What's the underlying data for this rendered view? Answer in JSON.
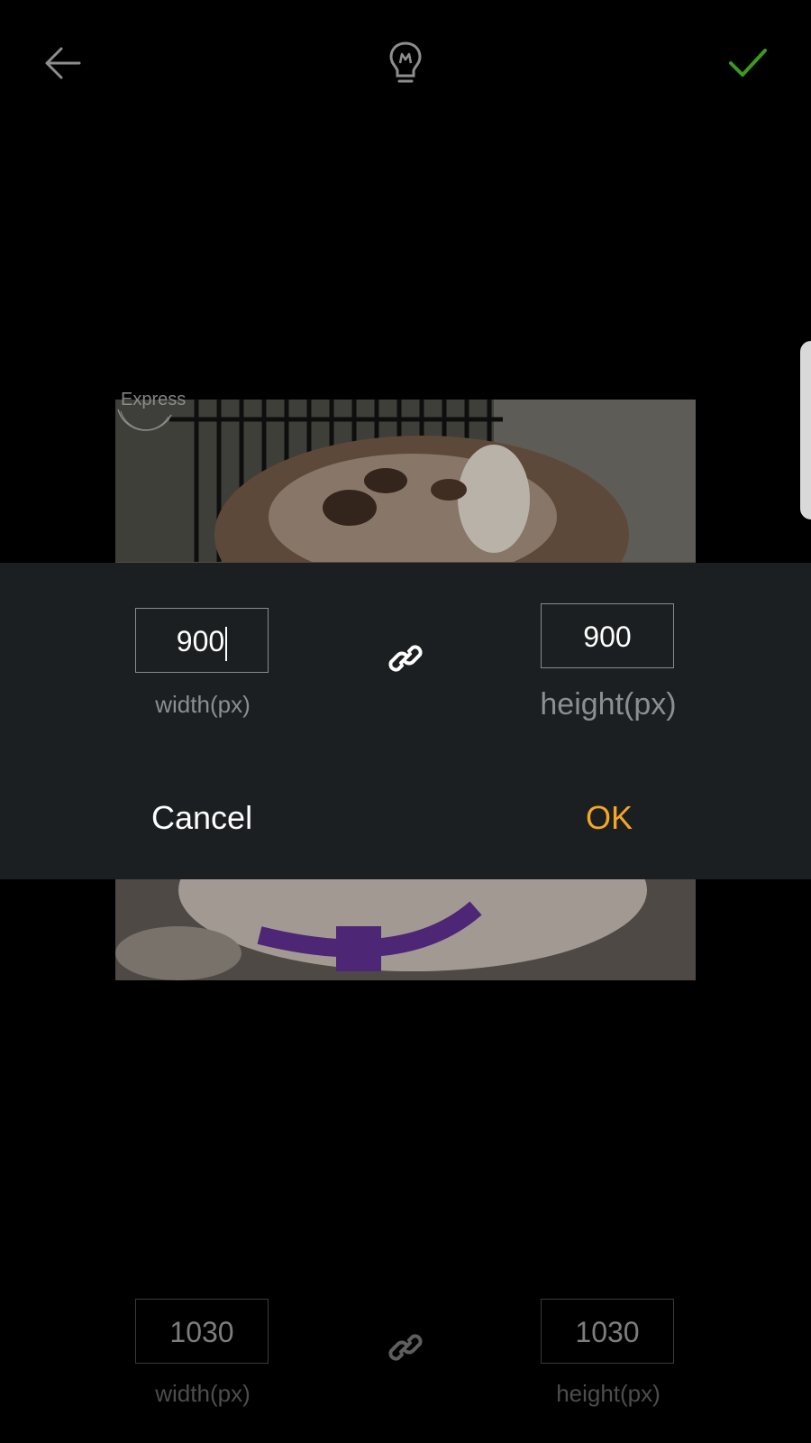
{
  "toolbar": {
    "back_icon": "arrow-left-icon",
    "tip_icon": "lightbulb-icon",
    "confirm_icon": "checkmark-icon",
    "confirm_color": "#3c9a1e"
  },
  "photo": {
    "watermark": "Express"
  },
  "dialog": {
    "width_value": "900",
    "width_label": "width(px)",
    "height_value": "900",
    "height_label": "height(px)",
    "link_icon": "link-chain-icon",
    "cancel_label": "Cancel",
    "ok_label": "OK",
    "ok_color": "#f5a623"
  },
  "background_controls": {
    "width_value": "1030",
    "width_label": "width(px)",
    "height_value": "1030",
    "height_label": "height(px)",
    "link_icon": "link-chain-icon"
  }
}
